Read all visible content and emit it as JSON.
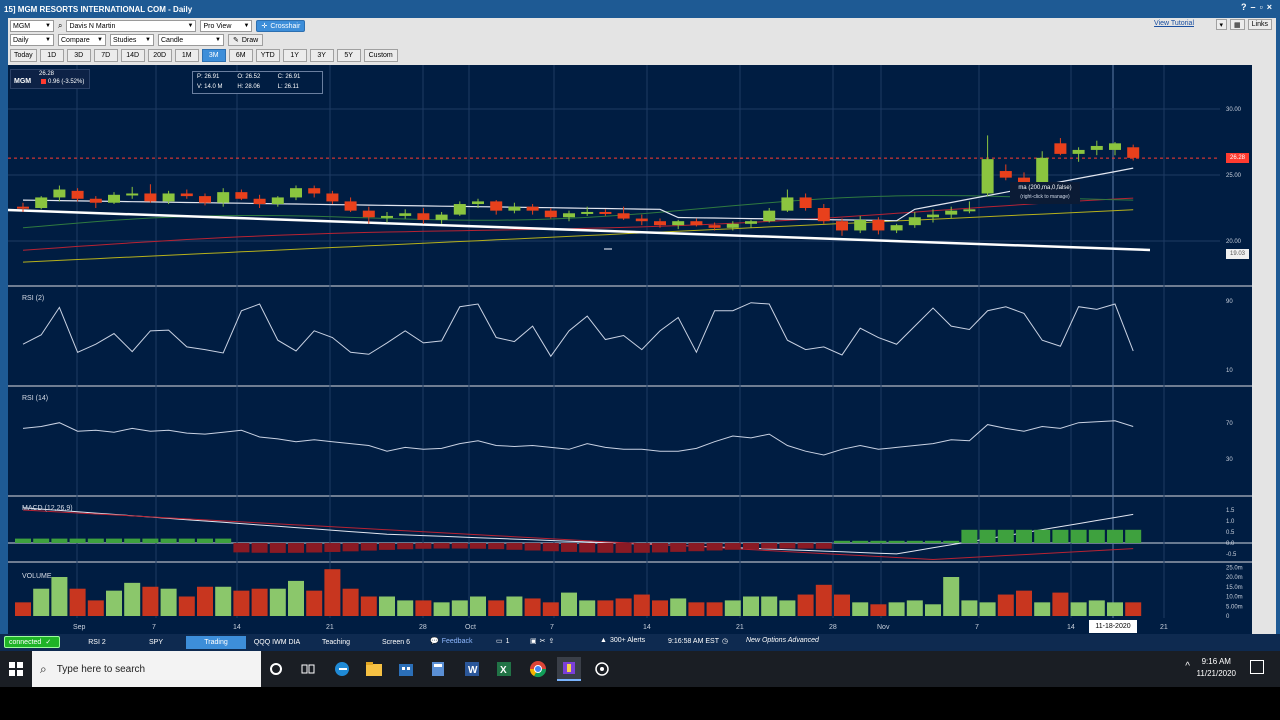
{
  "window": {
    "title": "15] MGM RESORTS INTERNATIONAL COM - Daily"
  },
  "toolbar": {
    "symbol": "MGM",
    "account": "Davis N Martin",
    "view": "Pro View",
    "crosshair": "Crosshair",
    "interval": "Daily",
    "compare": "Compare",
    "studies": "Studies",
    "chart_type": "Candle",
    "draw": "Draw",
    "view_tutorial": "View Tutorial",
    "links": "Links",
    "timeframes": [
      "Today",
      "1D",
      "3D",
      "7D",
      "14D",
      "20D",
      "1M",
      "3M",
      "6M",
      "YTD",
      "1Y",
      "3Y",
      "5Y",
      "Custom"
    ],
    "active_timeframe": "3M"
  },
  "quote": {
    "symbol": "MGM",
    "last": "26.28",
    "change": "0.96 (-3.52%)",
    "ohlc": [
      "P: 26.91",
      "O: 26.52",
      "C: 26.91",
      "V: 14.0 M",
      "H: 28.06",
      "L: 26.11"
    ]
  },
  "tooltip": {
    "title": "ma (200,ma,0,false)",
    "hint": "(right-click to manage)"
  },
  "price_labels": {
    "last": "26.28",
    "line": "19.03"
  },
  "panels": {
    "rsi2": "RSI (2)",
    "rsi14": "RSI (14)",
    "macd": "MACD (12,26,9)",
    "volume": "VOLUME"
  },
  "axes": {
    "price": [
      "30.00",
      "25.00",
      "20.00"
    ],
    "rsi2": [
      "90",
      "10"
    ],
    "rsi14": [
      "70",
      "30"
    ],
    "macd": [
      "1.5",
      "1.0",
      "0.5",
      "0.0",
      "-0.5"
    ],
    "volume": [
      "25.0m",
      "20.0m",
      "15.0m",
      "10.0m",
      "5.00m",
      "0"
    ],
    "dates": [
      "Sep",
      "7",
      "14",
      "21",
      "28",
      "Oct",
      "7",
      "14",
      "21",
      "28",
      "Nov",
      "7",
      "14",
      "21"
    ],
    "hover_date": "11-18-2020"
  },
  "chart_data": {
    "type": "candlestick",
    "candles_ohlc": [
      [
        22.6,
        22.9,
        22.2,
        22.5
      ],
      [
        22.5,
        23.4,
        22.4,
        23.3
      ],
      [
        23.3,
        24.2,
        23.0,
        23.9
      ],
      [
        23.8,
        24.0,
        23.0,
        23.2
      ],
      [
        23.2,
        23.4,
        22.5,
        22.9
      ],
      [
        22.9,
        23.7,
        22.8,
        23.5
      ],
      [
        23.5,
        24.1,
        23.2,
        23.6
      ],
      [
        23.6,
        24.3,
        22.9,
        23.0
      ],
      [
        23.0,
        23.8,
        22.8,
        23.6
      ],
      [
        23.6,
        23.9,
        23.2,
        23.4
      ],
      [
        23.4,
        23.6,
        22.7,
        22.9
      ],
      [
        22.9,
        24.0,
        22.6,
        23.7
      ],
      [
        23.7,
        23.9,
        23.1,
        23.2
      ],
      [
        23.2,
        23.5,
        22.5,
        22.8
      ],
      [
        22.8,
        23.4,
        22.6,
        23.3
      ],
      [
        23.3,
        24.2,
        23.1,
        24.0
      ],
      [
        24.0,
        24.2,
        23.3,
        23.6
      ],
      [
        23.6,
        23.8,
        22.8,
        23.0
      ],
      [
        23.0,
        23.3,
        22.2,
        22.3
      ],
      [
        22.3,
        22.6,
        21.3,
        21.8
      ],
      [
        21.8,
        22.2,
        21.4,
        21.9
      ],
      [
        21.9,
        22.4,
        21.7,
        22.1
      ],
      [
        22.1,
        22.5,
        21.3,
        21.6
      ],
      [
        21.6,
        22.2,
        21.3,
        22.0
      ],
      [
        22.0,
        23.0,
        21.9,
        22.8
      ],
      [
        22.8,
        23.2,
        22.5,
        23.0
      ],
      [
        23.0,
        23.1,
        22.0,
        22.3
      ],
      [
        22.3,
        22.9,
        22.1,
        22.6
      ],
      [
        22.6,
        22.8,
        22.0,
        22.3
      ],
      [
        22.3,
        22.5,
        21.7,
        21.8
      ],
      [
        21.8,
        22.3,
        21.5,
        22.1
      ],
      [
        22.1,
        22.6,
        21.9,
        22.2
      ],
      [
        22.2,
        22.4,
        21.9,
        22.1
      ],
      [
        22.1,
        22.6,
        21.6,
        21.7
      ],
      [
        21.7,
        22.0,
        21.2,
        21.5
      ],
      [
        21.5,
        21.7,
        21.0,
        21.2
      ],
      [
        21.2,
        21.6,
        20.9,
        21.5
      ],
      [
        21.5,
        21.7,
        21.1,
        21.2
      ],
      [
        21.2,
        21.4,
        20.8,
        21.0
      ],
      [
        21.0,
        21.5,
        20.8,
        21.3
      ],
      [
        21.3,
        21.6,
        21.0,
        21.5
      ],
      [
        21.5,
        22.5,
        21.4,
        22.3
      ],
      [
        22.3,
        23.9,
        22.2,
        23.3
      ],
      [
        23.3,
        23.6,
        22.3,
        22.5
      ],
      [
        22.5,
        22.8,
        21.3,
        21.5
      ],
      [
        21.5,
        21.7,
        20.4,
        20.8
      ],
      [
        20.8,
        21.9,
        20.6,
        21.6
      ],
      [
        21.6,
        21.8,
        20.5,
        20.8
      ],
      [
        20.8,
        21.3,
        20.6,
        21.2
      ],
      [
        21.2,
        22.2,
        21.0,
        21.8
      ],
      [
        21.8,
        22.4,
        21.4,
        22.0
      ],
      [
        22.0,
        22.6,
        21.7,
        22.3
      ],
      [
        22.3,
        23.0,
        22.1,
        22.4
      ],
      [
        23.6,
        28.0,
        23.4,
        26.2
      ],
      [
        25.3,
        25.8,
        24.6,
        24.8
      ],
      [
        24.8,
        25.2,
        24.2,
        24.4
      ],
      [
        24.4,
        26.8,
        24.2,
        26.3
      ],
      [
        27.4,
        27.8,
        26.5,
        26.6
      ],
      [
        26.6,
        27.1,
        26.0,
        26.9
      ],
      [
        26.9,
        27.6,
        26.5,
        27.2
      ],
      [
        26.9,
        27.5,
        26.5,
        27.4
      ],
      [
        27.1,
        27.3,
        26.1,
        26.3
      ]
    ]
  }
}
